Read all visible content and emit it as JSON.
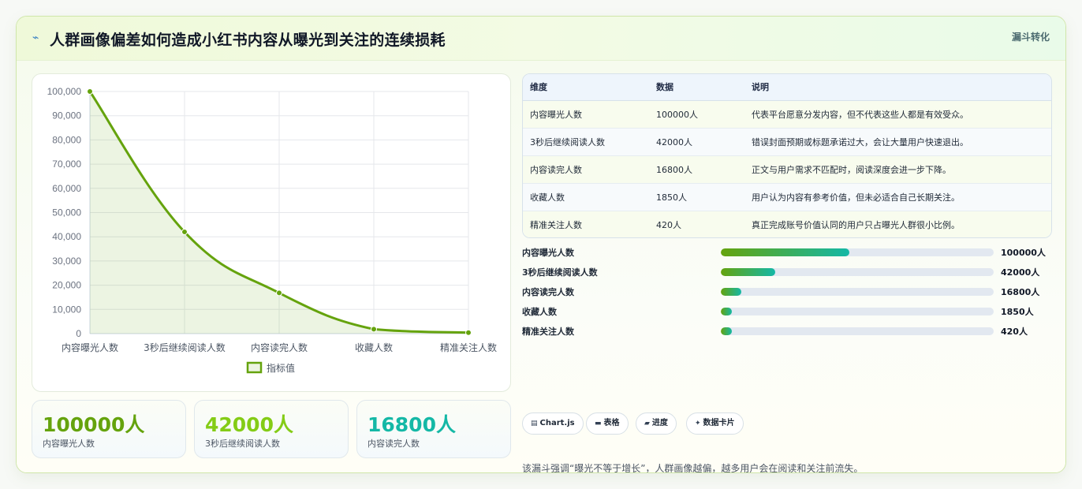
{
  "header": {
    "icon": "trend-icon",
    "title": "人群画像偏差如何造成小红书内容从曝光到关注的连续损耗",
    "tag": "漏斗转化"
  },
  "chart_data": {
    "type": "line",
    "categories": [
      "内容曝光人数",
      "3秒后继续阅读人数",
      "内容读完人数",
      "收藏人数",
      "精准关注人数"
    ],
    "series": [
      {
        "name": "指标值",
        "values": [
          100000,
          42000,
          16800,
          1850,
          420
        ]
      }
    ],
    "ylim": [
      0,
      100000
    ],
    "yticks": [
      "0",
      "10,000",
      "20,000",
      "30,000",
      "40,000",
      "50,000",
      "60,000",
      "70,000",
      "80,000",
      "90,000",
      "100,000"
    ],
    "grid": true,
    "fill": true,
    "legend": "bottom",
    "colors": {
      "line": "#65a30d",
      "fill": "rgba(101,163,13,0.12)"
    }
  },
  "stats": [
    {
      "value": "100000人",
      "label": "内容曝光人数",
      "color": "#65a30d"
    },
    {
      "value": "42000人",
      "label": "3秒后继续阅读人数",
      "color": "#84cc16"
    },
    {
      "value": "16800人",
      "label": "内容读完人数",
      "color": "#14b8a6"
    }
  ],
  "table": {
    "headers": [
      "维度",
      "数据",
      "说明"
    ],
    "rows": [
      [
        "内容曝光人数",
        "100000人",
        "代表平台愿意分发内容，但不代表这些人都是有效受众。"
      ],
      [
        "3秒后继续阅读人数",
        "42000人",
        "错误封面预期或标题承诺过大，会让大量用户快速退出。"
      ],
      [
        "内容读完人数",
        "16800人",
        "正文与用户需求不匹配时，阅读深度会进一步下降。"
      ],
      [
        "收藏人数",
        "1850人",
        "用户认为内容有参考价值，但未必适合自己长期关注。"
      ],
      [
        "精准关注人数",
        "420人",
        "真正完成账号价值认同的用户只占曝光人群很小比例。"
      ]
    ]
  },
  "progress": [
    {
      "label": "内容曝光人数",
      "value": "100000人",
      "fraction": 0.47
    },
    {
      "label": "3秒后继续阅读人数",
      "value": "42000人",
      "fraction": 0.2
    },
    {
      "label": "内容读完人数",
      "value": "16800人",
      "fraction": 0.075
    },
    {
      "label": "收藏人数",
      "value": "1850人",
      "fraction": 0.04
    },
    {
      "label": "精准关注人数",
      "value": "420人",
      "fraction": 0.04
    }
  ],
  "tags": [
    {
      "icon": "chart-icon",
      "glyph": "▤",
      "label": "Chart.js"
    },
    {
      "icon": "table-icon",
      "glyph": "▬",
      "label": "表格"
    },
    {
      "icon": "progress-icon",
      "glyph": "▰",
      "label": "进度"
    },
    {
      "icon": "sparkle-icon",
      "glyph": "✦",
      "label": "数据卡片"
    }
  ],
  "note": "该漏斗强调“曝光不等于增长”，人群画像越偏，越多用户会在阅读和关注前流失。"
}
